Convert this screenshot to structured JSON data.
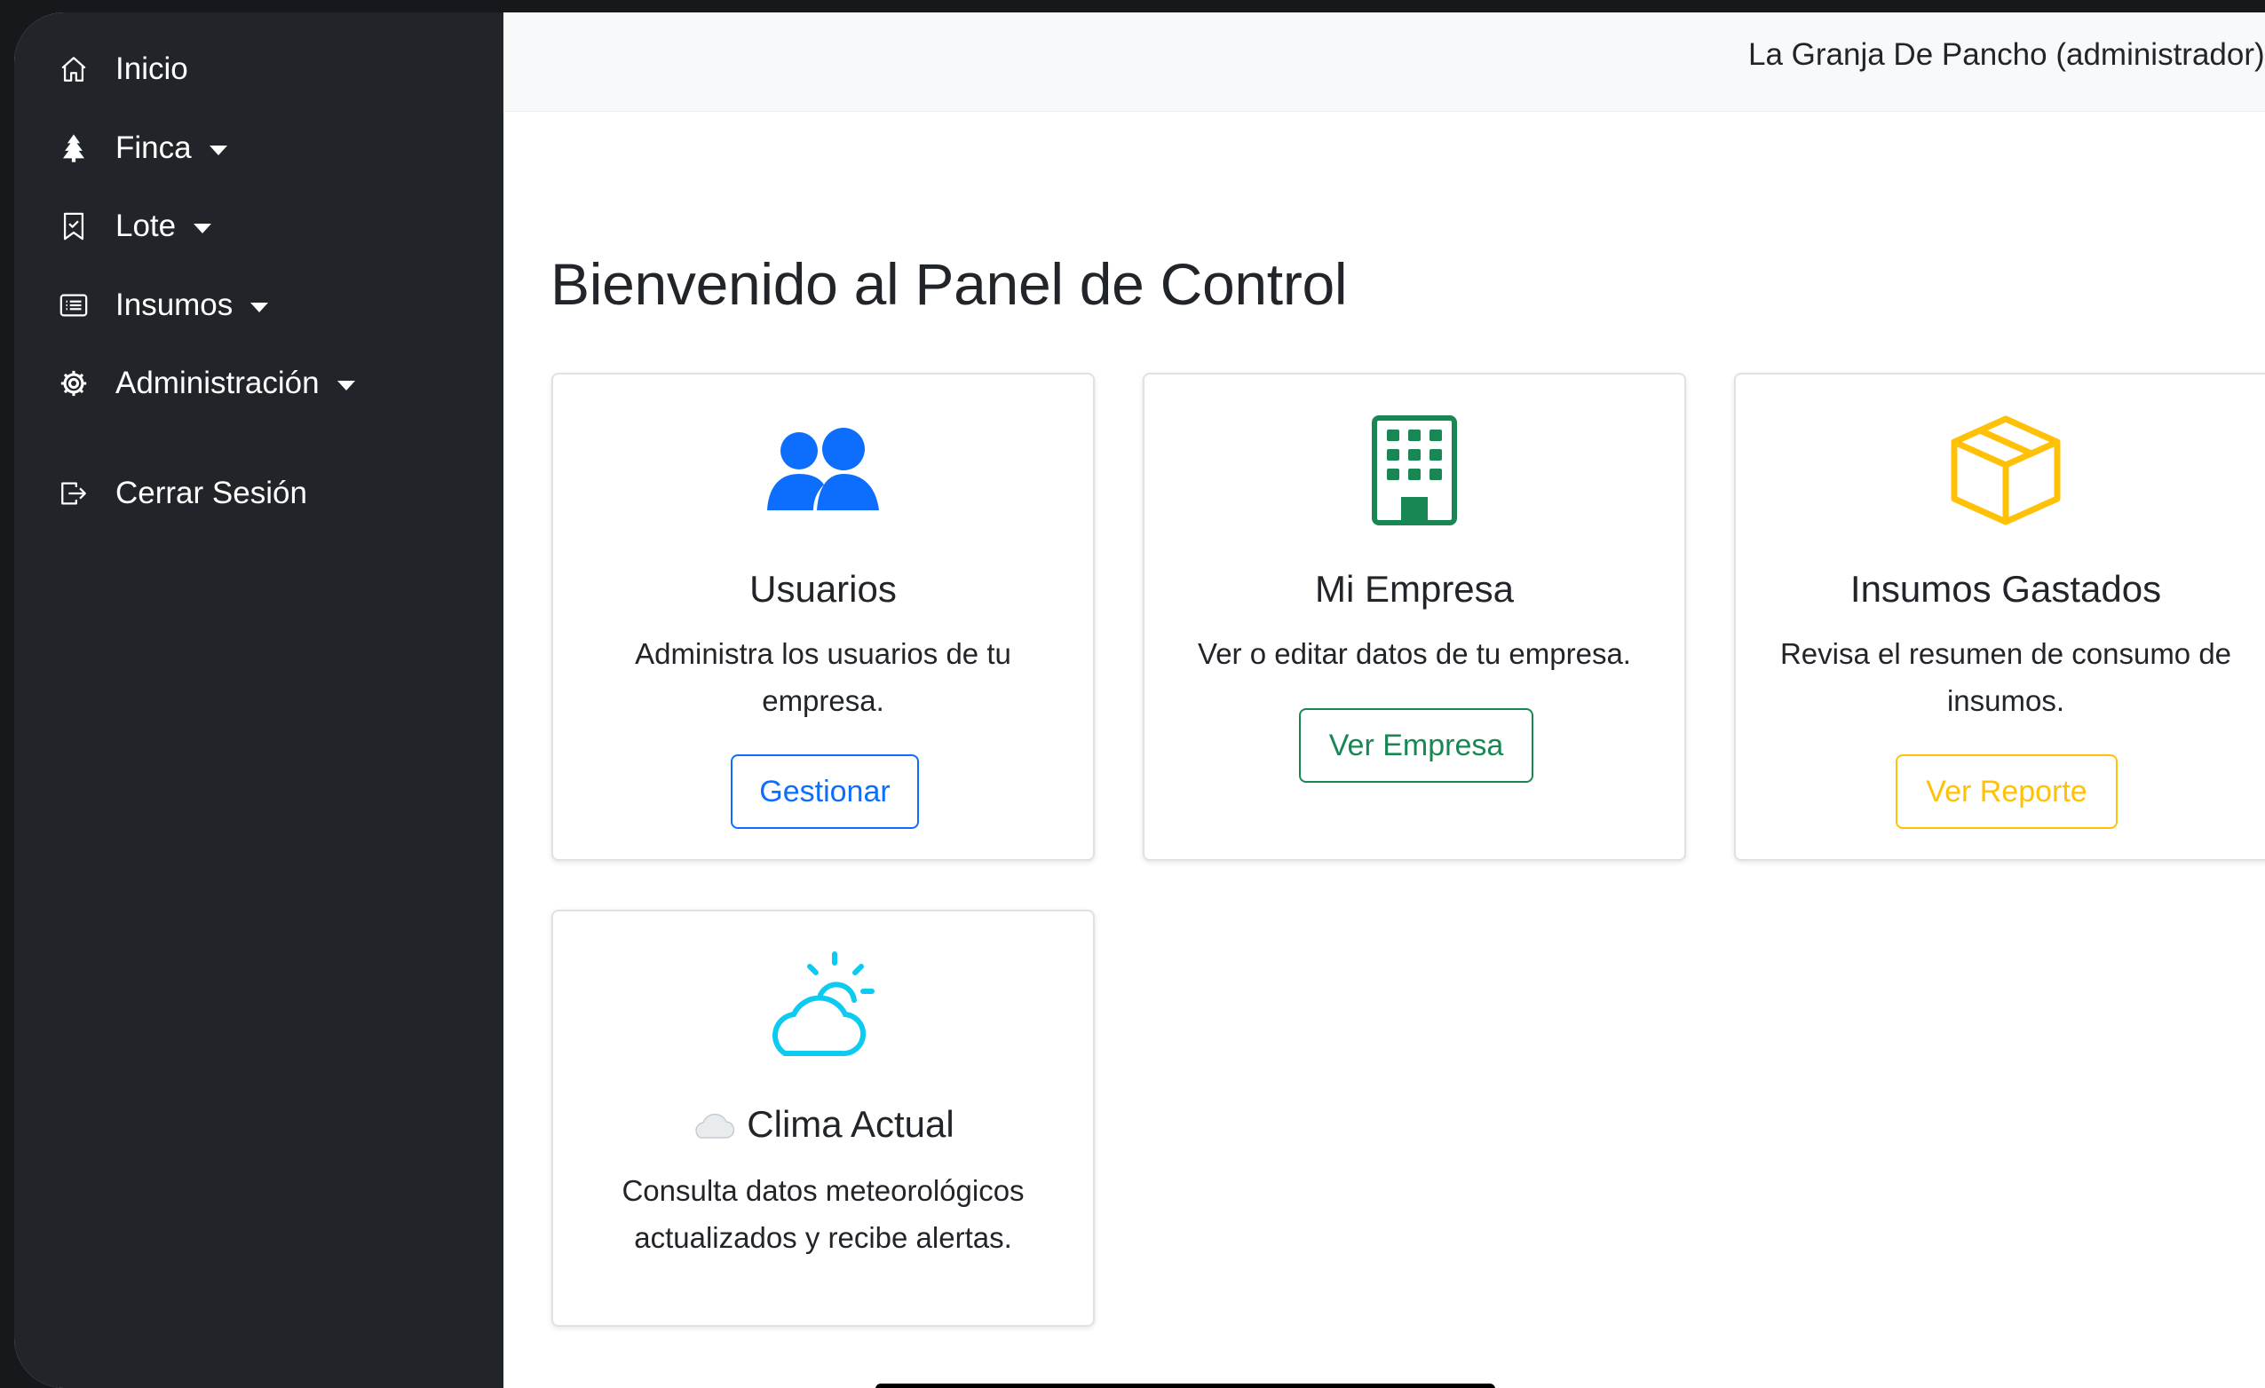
{
  "sidebar": {
    "items": [
      {
        "label": "Inicio",
        "icon": "house-icon"
      },
      {
        "label": "Finca",
        "icon": "tree-icon"
      },
      {
        "label": "Lote",
        "icon": "bookmark-icon"
      },
      {
        "label": "Insumos",
        "icon": "list-icon"
      },
      {
        "label": "Administración",
        "icon": "gear-icon"
      },
      {
        "label": "Cerrar Sesión",
        "icon": "logout-icon"
      }
    ]
  },
  "header": {
    "user": "La Granja De Pancho (administrador)"
  },
  "main": {
    "title": "Bienvenido al Panel de Control",
    "cards": [
      {
        "title": "Usuarios",
        "text": "Administra los usuarios de tu empresa.",
        "button": "Gestionar",
        "icon": "people-icon",
        "color": "#0d6efd"
      },
      {
        "title": "Mi Empresa",
        "text": "Ver o editar datos de tu empresa.",
        "button": "Ver Empresa",
        "icon": "building-icon",
        "color": "#198754"
      },
      {
        "title": "Insumos Gastados",
        "text": "Revisa el resumen de consumo de insumos.",
        "button": "Ver Reporte",
        "icon": "box-icon",
        "color": "#ffc107"
      },
      {
        "title": "Clima Actual",
        "text": "Consulta datos meteorológicos actualizados y recibe alertas.",
        "icon": "cloud-sun-icon",
        "color": "#0dcaf0"
      }
    ]
  }
}
